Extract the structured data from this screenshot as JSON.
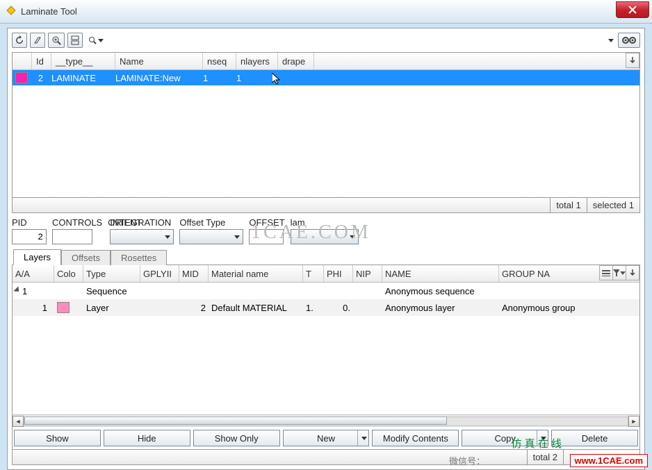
{
  "window": {
    "title": "Laminate Tool"
  },
  "top_grid": {
    "columns": [
      "Id",
      "__type__",
      "Name",
      "nseq",
      "nlayers",
      "drape"
    ],
    "row": {
      "swatch": "#ff1eb4",
      "Id": "2",
      "type": "LAMINATE",
      "Name": "LAMINATE:New",
      "nseq": "1",
      "nlayers": "1",
      "drape": ""
    },
    "status": {
      "total": "total 1",
      "selected": "selected 1"
    }
  },
  "form": {
    "pid": {
      "label": "PID",
      "value": "2"
    },
    "controls": {
      "label": "CONTROLS",
      "value": ""
    },
    "orient": {
      "label": "ORIENT",
      "value": ""
    },
    "integration": {
      "label": "INTEGRATION"
    },
    "offset_type": {
      "label": "Offset Type"
    },
    "offset": {
      "label": "OFFSET",
      "value": ""
    },
    "lam": {
      "label": "lam"
    }
  },
  "tabs": {
    "layers": "Layers",
    "offsets": "Offsets",
    "rosettes": "Rosettes"
  },
  "layers_grid": {
    "columns": [
      "A/A",
      "Colo",
      "Type",
      "GPLYII",
      "MID",
      "Material name",
      "T",
      "PHI",
      "NIP",
      "NAME",
      "GROUP NA"
    ],
    "rows": [
      {
        "aa": "1",
        "tree": true,
        "color": "",
        "type": "Sequence",
        "gply": "",
        "mid": "",
        "mat": "",
        "t": "",
        "phi": "",
        "nip": "",
        "name": "Anonymous sequence",
        "group": ""
      },
      {
        "aa": "1",
        "tree": false,
        "color": "#ff8bbf",
        "type": "Layer",
        "gply": "",
        "mid": "2",
        "mat": "Default MATERIAL",
        "t": "1.",
        "phi": "0.",
        "nip": "",
        "name": "Anonymous layer",
        "group": "Anonymous group"
      }
    ],
    "status_total": "total 2"
  },
  "buttons": {
    "show": "Show",
    "hide": "Hide",
    "show_only": "Show Only",
    "new": "New",
    "modify": "Modify Contents",
    "copy": "Copy",
    "delete": "Delete"
  },
  "watermark": {
    "url": "www.1CAE.com"
  },
  "faint_text": "1CAE.COM",
  "wechat_hint": "微信号：",
  "cn_overlay": "仿 真 在 线"
}
